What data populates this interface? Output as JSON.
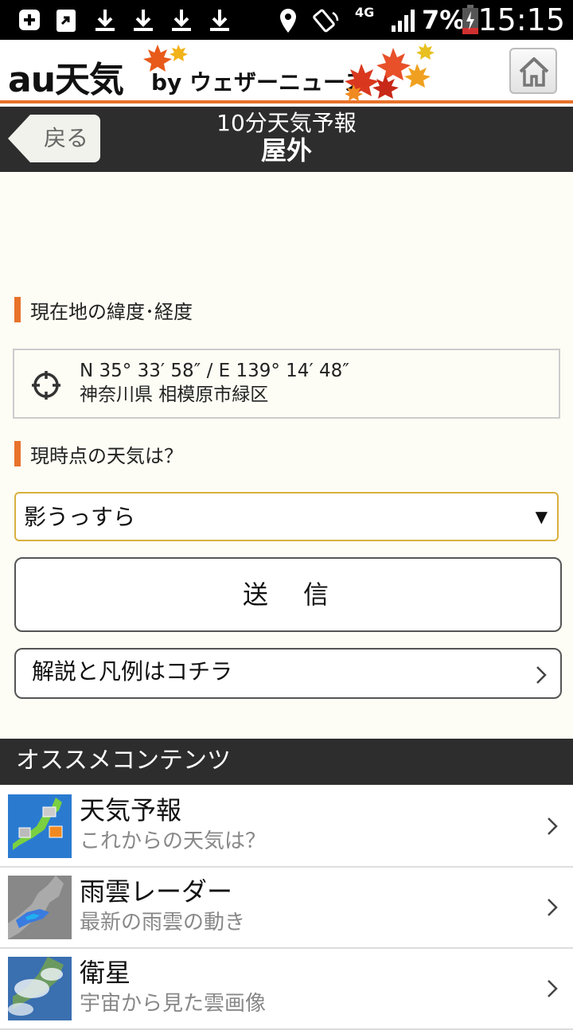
{
  "status_bar": {
    "battery_percent": "7%",
    "time": "15:15",
    "network": "4G"
  },
  "header": {
    "logo_au": "au",
    "logo_tenki": "天気",
    "by_text": "by ウェザーニュース",
    "home_icon": "home-icon"
  },
  "titlebar": {
    "back_label": "戻る",
    "title": "10分天気予報",
    "subtitle": "屋外"
  },
  "location": {
    "heading": "現在地の緯度･経度",
    "coords": "N 35°  33′  58″   / E 139°  14′  48″",
    "place": "神奈川県 相模原市緑区",
    "icon": "location-target-icon"
  },
  "weather": {
    "heading": "現時点の天気は？",
    "selected": "影うっすら",
    "send_label": "送　信"
  },
  "guide": {
    "label": "解説と凡例はコチラ"
  },
  "recommend": {
    "heading": "オススメコンテンツ",
    "items": [
      {
        "title": "天気予報",
        "subtitle": "これからの天気は？"
      },
      {
        "title": "雨雲レーダー",
        "subtitle": "最新の雨雲の動き"
      },
      {
        "title": "衛星",
        "subtitle": "宇宙から見た雲画像"
      }
    ]
  },
  "colors": {
    "accent": "#e8722a",
    "dark_bar": "#2d2d2d",
    "select_border": "#d8b040"
  }
}
